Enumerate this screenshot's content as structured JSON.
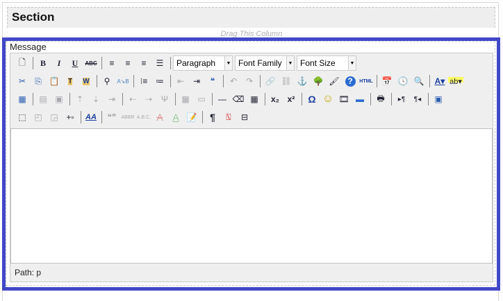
{
  "section": {
    "title": "Section",
    "drag_hint": "Drag This Column"
  },
  "field": {
    "label": "Message",
    "path": "Path: p"
  },
  "selects": {
    "format": "Paragraph",
    "font_family": "Font Family",
    "font_size": "Font Size"
  },
  "colors": {
    "highlight_border": "#4148c8",
    "toolbar_bg": "#efefef"
  },
  "toolbar": {
    "row1": [
      {
        "n": "new-document",
        "g": "🗋"
      },
      "|",
      {
        "n": "bold",
        "g": "B",
        "s": "font-weight:bold;font-family:'Liberation Serif',serif"
      },
      {
        "n": "italic",
        "g": "I",
        "s": "font-style:italic;font-weight:bold;font-family:'Liberation Serif',serif"
      },
      {
        "n": "underline",
        "g": "U",
        "s": "text-decoration:underline;font-weight:bold;font-family:'Liberation Serif',serif"
      },
      {
        "n": "strikethrough",
        "g": "ABC",
        "s": "text-decoration:line-through;font-size:8px;font-weight:bold"
      },
      "|",
      {
        "n": "align-left",
        "g": "≡"
      },
      {
        "n": "align-center",
        "g": "≡"
      },
      {
        "n": "align-right",
        "g": "≡"
      },
      {
        "n": "align-justify",
        "g": "☰"
      },
      "|"
    ],
    "row2": [
      {
        "n": "cut",
        "g": "✂",
        "s": "color:#2a5db0"
      },
      {
        "n": "copy",
        "g": "⎘",
        "s": "color:#2a5db0"
      },
      {
        "n": "paste",
        "g": "📋"
      },
      {
        "n": "paste-text",
        "g": "T",
        "s": "background:#e8c66a;font-size:10px;font-weight:bold"
      },
      {
        "n": "paste-word",
        "g": "W",
        "s": "background:#e8c66a;font-size:10px;font-weight:bold;color:#1a3ea0"
      },
      "|",
      {
        "n": "find",
        "g": "⚲"
      },
      {
        "n": "replace",
        "g": "A↘B",
        "s": "font-size:8px;color:#4a80c0"
      },
      "|",
      {
        "n": "bullet-list",
        "g": "⁝≡"
      },
      {
        "n": "numbered-list",
        "g": "≔"
      },
      "|",
      {
        "n": "outdent",
        "g": "⇤",
        "d": true
      },
      {
        "n": "indent",
        "g": "⇥"
      },
      {
        "n": "blockquote",
        "g": "❝",
        "s": "color:#2a5db0"
      },
      "|",
      {
        "n": "undo",
        "g": "↶",
        "d": true
      },
      {
        "n": "redo",
        "g": "↷",
        "d": true
      },
      "|",
      {
        "n": "link",
        "g": "🔗",
        "d": true
      },
      {
        "n": "unlink",
        "g": "⛓",
        "d": true
      },
      {
        "n": "anchor",
        "g": "⚓",
        "s": "color:#1a3ea0"
      },
      {
        "n": "image",
        "g": "🌳"
      },
      {
        "n": "cleanup",
        "g": "🖌"
      },
      {
        "n": "help",
        "g": "?",
        "s": "color:#fff;background:#2a6bd0;border-radius:50%;width:15px;height:15px;font-weight:bold"
      },
      {
        "n": "html-source",
        "g": "HTML",
        "s": "font-size:7px;font-weight:bold;color:#1a3ea0"
      },
      "|",
      {
        "n": "insert-date",
        "g": "📅"
      },
      {
        "n": "insert-time",
        "g": "🕓"
      },
      {
        "n": "preview",
        "g": "🔍"
      },
      "|",
      {
        "n": "text-color",
        "g": "A▾",
        "s": "text-decoration:underline;font-weight:bold;color:#1a3ea0;width:30px"
      },
      {
        "n": "background-color",
        "g": "ab▾",
        "s": "font-size:11px;background:linear-gradient(#ff6 0 60%,transparent 60%);width:30px"
      }
    ],
    "row3": [
      {
        "n": "insert-table",
        "g": "▦",
        "s": "color:#2a5db0"
      },
      "|",
      {
        "n": "row-properties",
        "g": "▤",
        "d": true
      },
      {
        "n": "cell-properties",
        "g": "▣",
        "d": true
      },
      "|",
      {
        "n": "insert-row-before",
        "g": "⇡",
        "d": true
      },
      {
        "n": "insert-row-after",
        "g": "⇣",
        "d": true
      },
      {
        "n": "delete-row",
        "g": "⇥",
        "d": true
      },
      "|",
      {
        "n": "insert-col-before",
        "g": "⇠",
        "d": true
      },
      {
        "n": "insert-col-after",
        "g": "⇢",
        "d": true
      },
      {
        "n": "delete-col",
        "g": "Ψ",
        "d": true
      },
      "|",
      {
        "n": "split-cells",
        "g": "▦",
        "d": true
      },
      {
        "n": "merge-cells",
        "g": "▭",
        "d": true
      },
      "|",
      {
        "n": "horizontal-rule",
        "g": "—"
      },
      {
        "n": "remove-format",
        "g": "⌫"
      },
      {
        "n": "visual-aid",
        "g": "▦"
      },
      "|",
      {
        "n": "subscript",
        "g": "x₂",
        "s": "font-weight:bold"
      },
      {
        "n": "superscript",
        "g": "x²",
        "s": "font-weight:bold"
      },
      "|",
      {
        "n": "special-character",
        "g": "Ω",
        "s": "color:#1a3ea0;font-weight:bold;font-size:14px"
      },
      {
        "n": "emotions",
        "g": "☺",
        "s": "color:#c8a000;font-size:16px"
      },
      {
        "n": "media",
        "g": "🎞"
      },
      {
        "n": "advanced-hr",
        "g": "▬",
        "s": "color:#2a6bd0"
      },
      "|",
      {
        "n": "print",
        "g": "🖶"
      },
      "|",
      {
        "n": "left-to-right",
        "g": "▸¶",
        "s": "font-size:10px"
      },
      {
        "n": "right-to-left",
        "g": "¶◂",
        "s": "font-size:10px"
      },
      "|",
      {
        "n": "fullscreen",
        "g": "▣",
        "s": "color:#2a5db0"
      }
    ],
    "row4": [
      {
        "n": "insert-layer",
        "g": "⬚"
      },
      {
        "n": "move-forward",
        "g": "◰",
        "d": true
      },
      {
        "n": "move-backward",
        "g": "◲",
        "d": true
      },
      {
        "n": "absolute-position",
        "g": "+▫"
      },
      "|",
      {
        "n": "style-properties",
        "g": "AA",
        "s": "color:#1a3ea0;font-style:italic;text-decoration:underline;font-weight:bold;font-size:11px"
      },
      "|",
      {
        "n": "citation",
        "g": "❝❞",
        "d": true
      },
      {
        "n": "abbreviation",
        "g": "ABBR",
        "d": true,
        "s": "font-size:7px"
      },
      {
        "n": "acronym",
        "g": "A.B.C.",
        "d": true,
        "s": "font-size:7px"
      },
      {
        "n": "deletion",
        "g": "A",
        "d": true,
        "s": "text-decoration:line-through;color:#c00;font-size:14px"
      },
      {
        "n": "insertion",
        "g": "A",
        "d": true,
        "s": "text-decoration:underline;color:#080;font-size:14px"
      },
      {
        "n": "attributes",
        "g": "📝"
      },
      "|",
      {
        "n": "visual-characters",
        "g": "¶",
        "s": "font-weight:bold;font-size:14px"
      },
      {
        "n": "non-breaking-space",
        "g": "⍂",
        "s": "color:#c00"
      },
      {
        "n": "page-break",
        "g": "⊟"
      }
    ]
  }
}
